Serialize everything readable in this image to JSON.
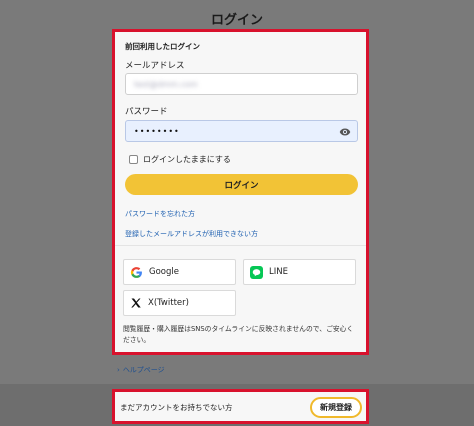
{
  "page": {
    "title": "ログイン"
  },
  "login_card": {
    "section_label": "前回利用したログイン",
    "email_label": "メールアドレス",
    "email_value": "test@dmm.com",
    "password_label": "パスワード",
    "password_value": "••••••••",
    "remember_label": "ログインしたままにする",
    "remember_checked": false,
    "login_button": "ログイン",
    "forgot_password_link": "パスワードを忘れた方",
    "cannot_use_email_link": "登録したメールアドレスが利用できない方",
    "sns": [
      {
        "label": "Google",
        "icon": "google-icon"
      },
      {
        "label": "LINE",
        "icon": "line-icon"
      },
      {
        "label": "X(Twitter)",
        "icon": "x-twitter-icon"
      }
    ],
    "note": "閲覧履歴・購入履歴はSNSのタイムラインに反映されませんので、ご安心ください。"
  },
  "help_link": "ヘルプページ",
  "signup": {
    "text": "まだアカウントをお持ちでない方",
    "button": "新規登録"
  },
  "colors": {
    "accent_yellow": "#f2c336",
    "highlight_red": "#d8122d",
    "link_blue": "#1d5fb0",
    "line_green": "#06c755"
  }
}
